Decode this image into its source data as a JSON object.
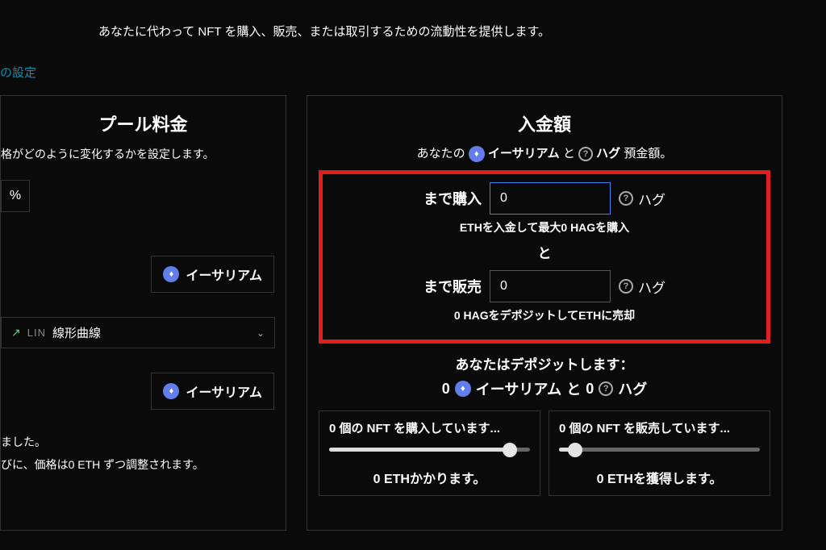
{
  "top_description": "あなたに代わって NFT を購入、販売、または取引するための流動性を提供します。",
  "settings_link": "の設定",
  "left": {
    "title": "プール料金",
    "subtitle": "格がどのように変化するかを設定します。",
    "percent": "%",
    "eth_label": "イーサリアム",
    "curve_lin": "LIN",
    "curve_label": "線形曲線",
    "note1": "ました。",
    "note2": "びに、価格は0 ETH ずつ調整されます。"
  },
  "right": {
    "title": "入金額",
    "deposit_line_prefix": "あなたの",
    "deposit_line_eth": "イーサリアム",
    "deposit_line_and": "と",
    "deposit_line_hag": "ハグ",
    "deposit_line_suffix": "預金額。",
    "buy_label": "まで購入",
    "buy_value": "0",
    "buy_hint": "ETHを入金して最大0 HAGを購入",
    "sell_label": "まで販売",
    "sell_value": "0",
    "sell_hint": "0 HAGをデポジットしてETHに売却",
    "and_sep": "と",
    "hag_label": "ハグ",
    "summary_title": "あなたはデポジットします：",
    "summary_eth_amount": "0",
    "summary_eth_label": "イーサリアム",
    "summary_and": "と",
    "summary_hag_amount": "0",
    "summary_hag_label": "ハグ",
    "sim_buy_title": "0 個の NFT を購入しています...",
    "sim_buy_result": "0 ETHかかります。",
    "sim_sell_title": "0 個の NFT を販売しています...",
    "sim_sell_result": "0 ETHを獲得します。"
  }
}
